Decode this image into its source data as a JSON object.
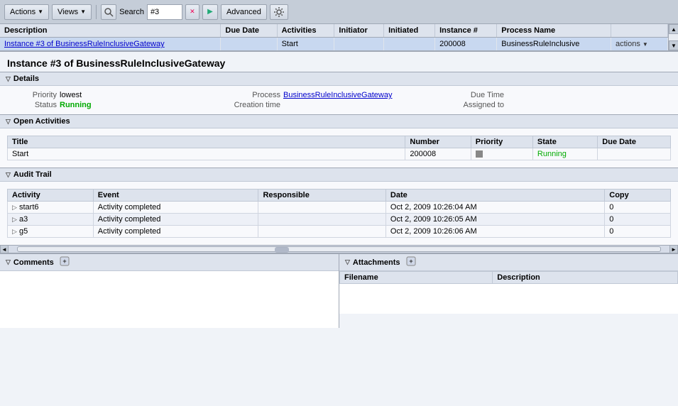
{
  "toolbar": {
    "actions_label": "Actions",
    "views_label": "Views",
    "search_label": "Search",
    "search_value": "#3",
    "advanced_label": "Advanced"
  },
  "results_table": {
    "columns": [
      "Description",
      "Due Date",
      "Activities",
      "Initiator",
      "Initiated",
      "Instance #",
      "Process Name",
      ""
    ],
    "rows": [
      {
        "description": "Instance #3 of BusinessRuleInclusiveGateway",
        "due_date": "",
        "activities": "Start",
        "initiator": "",
        "initiated": "",
        "instance_num": "200008",
        "process_name": "BusinessRuleInclusive",
        "actions": "actions"
      }
    ]
  },
  "detail": {
    "title": "Instance #3 of BusinessRuleInclusiveGateway",
    "sections": {
      "details": {
        "label": "Details",
        "priority_label": "Priority",
        "priority_value": "lowest",
        "status_label": "Status",
        "status_value": "Running",
        "process_label": "Process",
        "process_value": "BusinessRuleInclusiveGateway",
        "due_time_label": "Due Time",
        "due_time_value": "",
        "creation_time_label": "Creation time",
        "creation_time_value": "",
        "assigned_to_label": "Assigned to",
        "assigned_to_value": ""
      },
      "open_activities": {
        "label": "Open Activities",
        "columns": [
          "Title",
          "Number",
          "Priority",
          "State",
          "Due Date"
        ],
        "rows": [
          {
            "title": "Start",
            "number": "200008",
            "priority": "▪",
            "state": "Running",
            "due_date": ""
          }
        ]
      },
      "audit_trail": {
        "label": "Audit Trail",
        "columns": [
          "Activity",
          "Event",
          "Responsible",
          "Date",
          "Copy"
        ],
        "rows": [
          {
            "activity": "start6",
            "event": "Activity completed",
            "responsible": "",
            "date": "Oct 2, 2009 10:26:04 AM",
            "copy": "0"
          },
          {
            "activity": "a3",
            "event": "Activity completed",
            "responsible": "",
            "date": "Oct 2, 2009 10:26:05 AM",
            "copy": "0"
          },
          {
            "activity": "g5",
            "event": "Activity completed",
            "responsible": "",
            "date": "Oct 2, 2009 10:26:06 AM",
            "copy": "0"
          }
        ]
      }
    },
    "comments": {
      "label": "Comments"
    },
    "attachments": {
      "label": "Attachments",
      "columns": [
        "Filename",
        "Description"
      ]
    }
  }
}
